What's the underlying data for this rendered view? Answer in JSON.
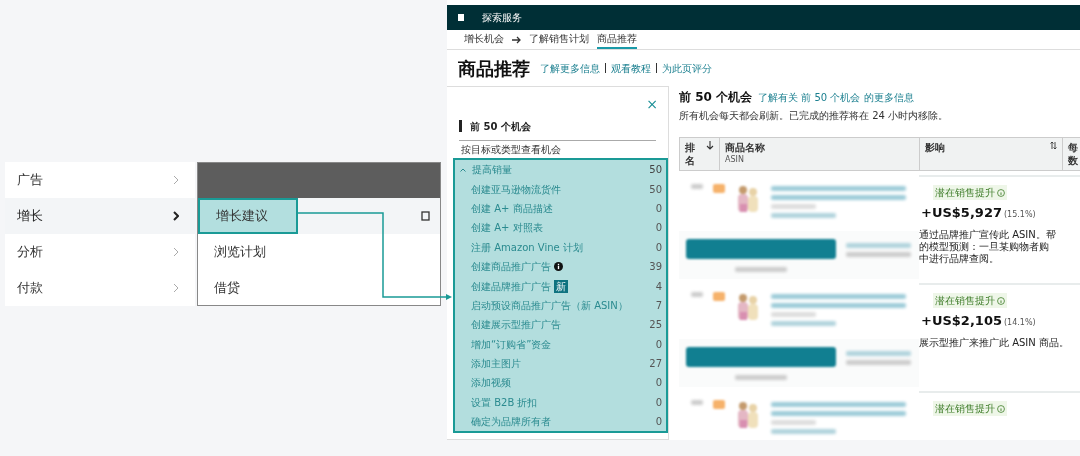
{
  "menu": {
    "items": [
      {
        "label": "广告",
        "selected": false
      },
      {
        "label": "增长",
        "selected": true
      },
      {
        "label": "分析",
        "selected": false
      },
      {
        "label": "付款",
        "selected": false
      }
    ]
  },
  "submenu": {
    "items": [
      {
        "label": "增长建议",
        "selected": true
      },
      {
        "label": "浏览计划",
        "selected": false
      },
      {
        "label": "借贷",
        "selected": false
      }
    ]
  },
  "app": {
    "top_bar": {
      "title": "探索服务"
    },
    "breadcrumb": [
      {
        "label": "增长机会",
        "selected": false
      },
      {
        "label": "了解销售计划",
        "selected": false
      },
      {
        "label": "商品推荐",
        "selected": true
      }
    ],
    "page_title": "商品推荐",
    "header_links": [
      "了解更多信息",
      "观看教程",
      "为此页评分"
    ],
    "filter_panel": {
      "close": "×",
      "section": "前 50 个机会",
      "subtitle": "按目标或类型查看机会",
      "group": {
        "label": "提高销量",
        "count": "50",
        "expanded": true,
        "items": [
          {
            "label": "创建亚马逊物流货件",
            "count": "50"
          },
          {
            "label": "创建 A+ 商品描述",
            "count": "0"
          },
          {
            "label": "创建 A+ 对照表",
            "count": "0"
          },
          {
            "label": "注册 Amazon Vine 计划",
            "count": "0"
          },
          {
            "label": "创建商品推广广告",
            "count": "39",
            "info": true
          },
          {
            "label": "创建品牌推广广告",
            "count": "4",
            "badge": "新"
          },
          {
            "label": "启动预设商品推广广告（新 ASIN）",
            "count": "7"
          },
          {
            "label": "创建展示型推广广告",
            "count": "25"
          },
          {
            "label": "增加“订购省”资金",
            "count": "0"
          },
          {
            "label": "添加主图片",
            "count": "27"
          },
          {
            "label": "添加视频",
            "count": "0"
          },
          {
            "label": "设置 B2B 折扣",
            "count": "0"
          },
          {
            "label": "确定为品牌所有者",
            "count": "0"
          }
        ]
      }
    },
    "main": {
      "title": "前 50 个机会",
      "link": "了解有关 前 50 个机会 的更多信息",
      "note": "所有机会每天都会刷新。已完成的推荐将在 24 小时内移除。",
      "table": {
        "columns": [
          {
            "label": "排名",
            "sorted": true
          },
          {
            "label": "商品名称",
            "sublabel": "ASIN"
          },
          {
            "label": "影响",
            "sorted": false
          },
          {
            "label": "每数"
          }
        ],
        "rows": [
          {
            "impact_label": "潜在销售提升",
            "impact": "+US$5,927",
            "change": "(15.1%)",
            "description_lines": [
              "通过品牌推广宣传此 ASIN。帮",
              "的模型预测：一旦某购物者购",
              "中进行品牌查阅。"
            ]
          },
          {
            "impact_label": "潜在销售提升",
            "impact": "+US$2,105",
            "change": "(14.1%)",
            "description_lines": [
              "展示型推广来推广此 ASIN 商品。"
            ]
          },
          {
            "impact_label": "潜在销售提升"
          }
        ]
      }
    }
  }
}
